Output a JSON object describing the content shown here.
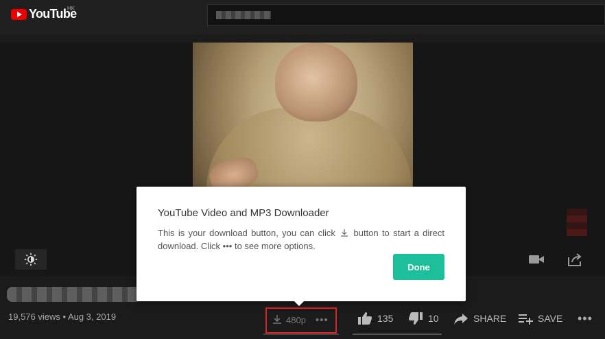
{
  "header": {
    "logo_text": "YouTube",
    "logo_region": "HK",
    "logo_icon": "youtube-play-icon"
  },
  "video": {
    "views_date": "19,576 views • Aug 3, 2019"
  },
  "downloader": {
    "quality": "480p",
    "more": "•••"
  },
  "actions": {
    "likes": "135",
    "dislikes": "10",
    "share": "SHARE",
    "save": "SAVE",
    "more": "•••"
  },
  "popup": {
    "title": "YouTube Video and MP3 Downloader",
    "body_part1": "This is your download button, you can click",
    "body_part2": "button to start a direct download. Click",
    "body_dots": "•••",
    "body_part3": "to see more options.",
    "done_label": "Done"
  },
  "colors": {
    "accent": "#1cbf9a",
    "highlight_border": "#e02020",
    "youtube_red": "#ee0000"
  }
}
